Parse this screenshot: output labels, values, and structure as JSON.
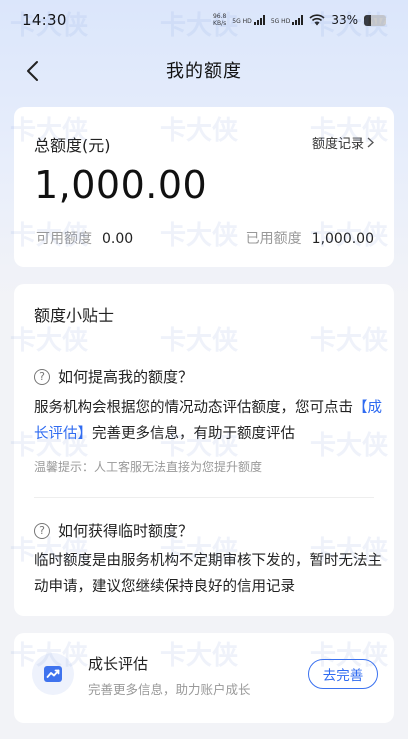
{
  "status_bar": {
    "time": "14:30",
    "net_speed": "96.8",
    "net_unit": "KB/s",
    "sig1": "5G HD",
    "sig2": "5G HD",
    "battery": "33%",
    "battery_level": 0.33
  },
  "nav": {
    "title": "我的额度"
  },
  "quota": {
    "title": "总额度(元)",
    "record_link": "额度记录",
    "amount": "1,000.00",
    "available_label": "可用额度",
    "available_value": "0.00",
    "used_label": "已用额度",
    "used_value": "1,000.00"
  },
  "tips": {
    "title": "额度小贴士",
    "q1": "如何提高我的额度？",
    "a1_before": "服务机构会根据您的情况动态评估额度，您可点击",
    "a1_link": "【成长评估】",
    "a1_after": "完善更多信息，有助于额度评估",
    "hint": "温馨提示：人工客服无法直接为您提升额度",
    "q2": "如何获得临时额度？",
    "a2": "临时额度是由服务机构不定期审核下发的，暂时无法主动申请，建议您继续保持良好的信用记录"
  },
  "growth": {
    "title": "成长评估",
    "subtitle": "完善更多信息，助力账户成长",
    "button": "去完善"
  },
  "colors": {
    "accent": "#2f6bf1",
    "page_bg": "#f2f3f7"
  },
  "watermark": "卡大侠"
}
